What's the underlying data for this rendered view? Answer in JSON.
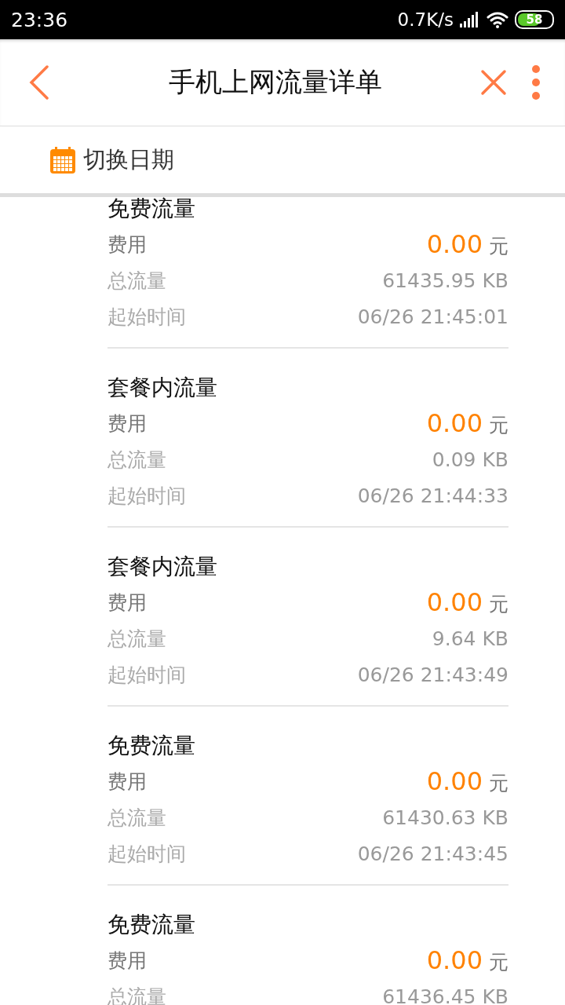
{
  "status_bar": {
    "time": "23:36",
    "speed": "0.7K/s",
    "battery": "58"
  },
  "header": {
    "title": "手机上网流量详单"
  },
  "date_switch": {
    "label": "切换日期"
  },
  "records": [
    {
      "title": "免费流量",
      "fee_label": "费用",
      "fee": "0.00",
      "fee_unit": "元",
      "total_label": "总流量",
      "total": "61435.95 KB",
      "start_label": "起始时间",
      "start": "06/26 21:45:01"
    },
    {
      "title": "套餐内流量",
      "fee_label": "费用",
      "fee": "0.00",
      "fee_unit": "元",
      "total_label": "总流量",
      "total": "0.09 KB",
      "start_label": "起始时间",
      "start": "06/26 21:44:33"
    },
    {
      "title": "套餐内流量",
      "fee_label": "费用",
      "fee": "0.00",
      "fee_unit": "元",
      "total_label": "总流量",
      "total": "9.64 KB",
      "start_label": "起始时间",
      "start": "06/26 21:43:49"
    },
    {
      "title": "免费流量",
      "fee_label": "费用",
      "fee": "0.00",
      "fee_unit": "元",
      "total_label": "总流量",
      "total": "61430.63 KB",
      "start_label": "起始时间",
      "start": "06/26 21:43:45"
    },
    {
      "title": "免费流量",
      "fee_label": "费用",
      "fee": "0.00",
      "fee_unit": "元",
      "total_label": "总流量",
      "total": "61436.45 KB"
    }
  ]
}
